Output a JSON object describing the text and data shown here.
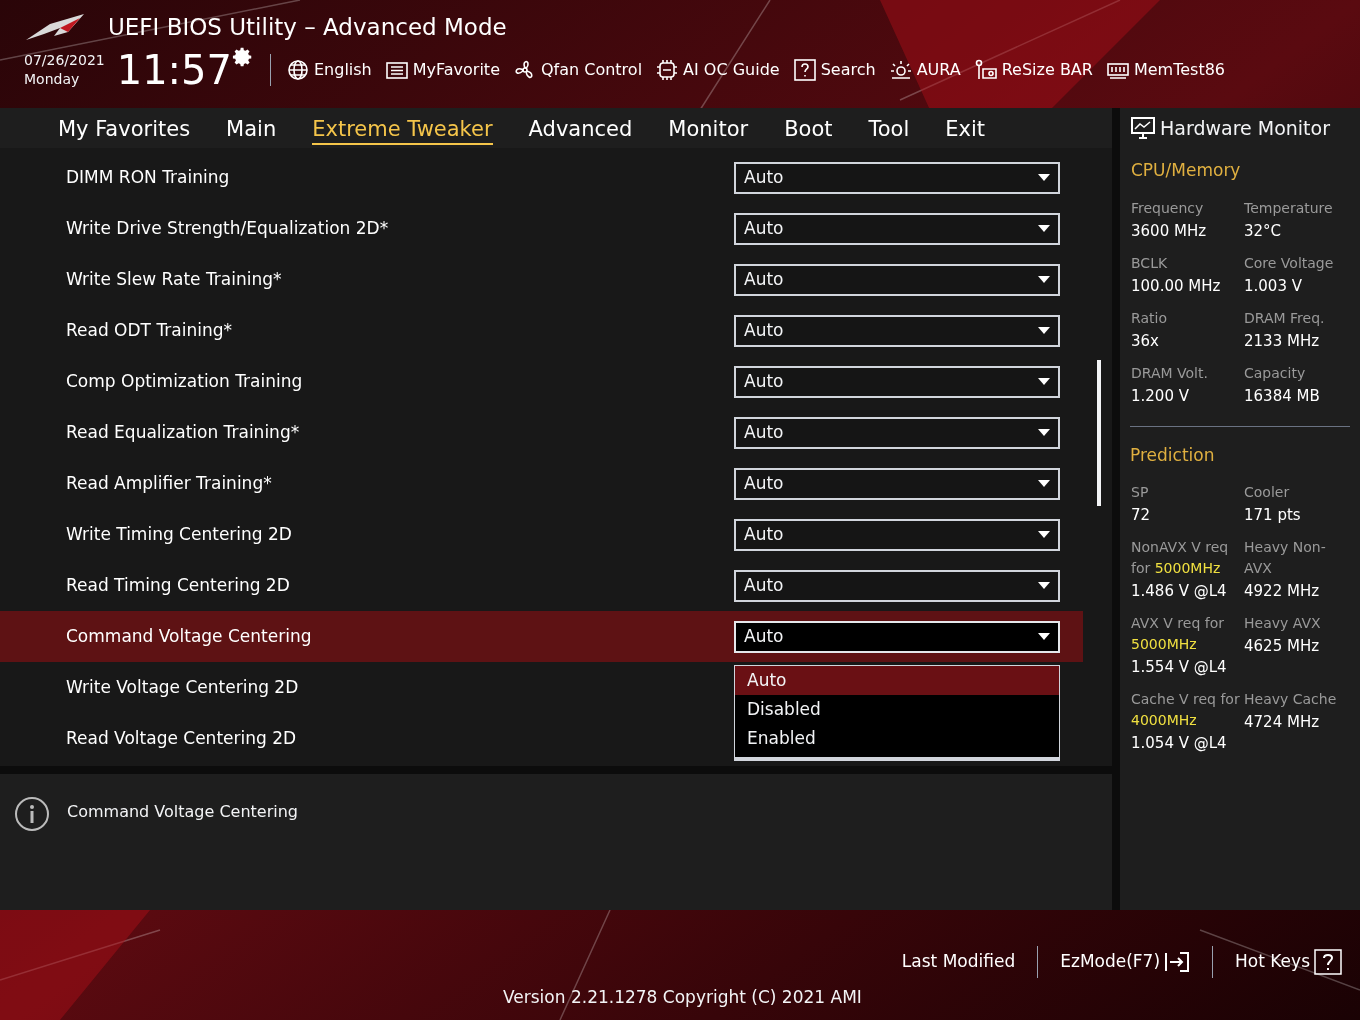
{
  "header": {
    "title": "UEFI BIOS Utility – Advanced Mode",
    "date": "07/26/2021",
    "day": "Monday",
    "time": "11:57",
    "toolbar": [
      "English",
      "MyFavorite",
      "Qfan Control",
      "AI OC Guide",
      "Search",
      "AURA",
      "ReSize BAR",
      "MemTest86"
    ]
  },
  "tabs": [
    {
      "label": "My Favorites",
      "selected": false
    },
    {
      "label": "Main",
      "selected": false
    },
    {
      "label": "Extreme Tweaker",
      "selected": true
    },
    {
      "label": "Advanced",
      "selected": false
    },
    {
      "label": "Monitor",
      "selected": false
    },
    {
      "label": "Boot",
      "selected": false
    },
    {
      "label": "Tool",
      "selected": false
    },
    {
      "label": "Exit",
      "selected": false
    }
  ],
  "settings": [
    {
      "label": "DIMM RON Training",
      "value": "Auto",
      "selected": false
    },
    {
      "label": "Write Drive Strength/Equalization 2D*",
      "value": "Auto",
      "selected": false
    },
    {
      "label": "Write Slew Rate Training*",
      "value": "Auto",
      "selected": false
    },
    {
      "label": "Read ODT Training*",
      "value": "Auto",
      "selected": false
    },
    {
      "label": "Comp Optimization Training",
      "value": "Auto",
      "selected": false
    },
    {
      "label": "Read Equalization Training*",
      "value": "Auto",
      "selected": false
    },
    {
      "label": "Read Amplifier Training*",
      "value": "Auto",
      "selected": false
    },
    {
      "label": "Write Timing Centering 2D",
      "value": "Auto",
      "selected": false
    },
    {
      "label": "Read Timing Centering 2D",
      "value": "Auto",
      "selected": false
    },
    {
      "label": "Command Voltage Centering",
      "value": "Auto",
      "selected": true,
      "options": [
        {
          "label": "Auto",
          "selected": true
        },
        {
          "label": "Disabled",
          "selected": false
        },
        {
          "label": "Enabled",
          "selected": false
        }
      ]
    },
    {
      "label": "Write Voltage Centering 2D",
      "selected": false
    },
    {
      "label": "Read Voltage Centering 2D",
      "selected": false
    }
  ],
  "help": {
    "text": "Command Voltage Centering"
  },
  "hardware_monitor": {
    "title": "Hardware Monitor",
    "sections": [
      {
        "title": "CPU/Memory",
        "items": [
          {
            "label": "Frequency",
            "value": "3600 MHz"
          },
          {
            "label": "Temperature",
            "value": "32°C"
          },
          {
            "label": "BCLK",
            "value": "100.00 MHz"
          },
          {
            "label": "Core Voltage",
            "value": "1.003 V"
          },
          {
            "label": "Ratio",
            "value": "36x"
          },
          {
            "label": "DRAM Freq.",
            "value": "2133 MHz"
          },
          {
            "label": "DRAM Volt.",
            "value": "1.200 V"
          },
          {
            "label": "Capacity",
            "value": "16384 MB"
          }
        ]
      },
      {
        "title": "Prediction",
        "items": [
          {
            "label": "SP",
            "value": "72"
          },
          {
            "label": "Cooler",
            "value": "171 pts"
          },
          {
            "label": "NonAVX V req for **5000MHz**",
            "value": "1.486 V @L4"
          },
          {
            "label": "Heavy Non-AVX",
            "value": "4922 MHz"
          },
          {
            "label": "AVX V req for **5000MHz**",
            "value": "1.554 V @L4"
          },
          {
            "label": "Heavy AVX",
            "value": "4625 MHz"
          },
          {
            "label": "Cache V req for **4000MHz**",
            "value": "1.054 V @L4"
          },
          {
            "label": "Heavy Cache",
            "value": "4724 MHz"
          }
        ]
      }
    ]
  },
  "footer": {
    "links": [
      "Last Modified",
      "EzMode(F7)",
      "Hot Keys"
    ],
    "version": "Version 2.21.1278 Copyright (C) 2021 AMI"
  }
}
